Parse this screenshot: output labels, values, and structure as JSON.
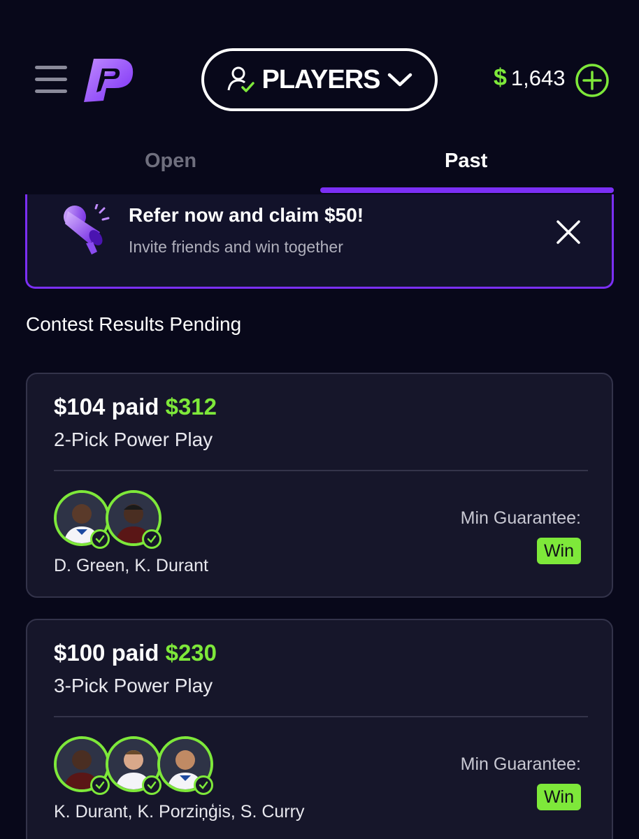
{
  "header": {
    "players_label": "PLAYERS",
    "balance_symbol": "$",
    "balance_amount": "1,643"
  },
  "tabs": [
    {
      "label": "Open",
      "active": false
    },
    {
      "label": "Past",
      "active": true
    }
  ],
  "banner": {
    "title": "Refer now and claim $50!",
    "subtitle": "Invite friends and win together"
  },
  "section_title": "Contest Results Pending",
  "contests": [
    {
      "paid": "$104 paid",
      "payout": "$312",
      "play_type": "2-Pick Power Play",
      "players": "D. Green, K. Durant",
      "min_guarantee_label": "Min Guarantee:",
      "result": "Win"
    },
    {
      "paid": "$100 paid",
      "payout": "$230",
      "play_type": "3-Pick Power Play",
      "players": "K. Durant, K. Porziņģis, S. Curry",
      "min_guarantee_label": "Min Guarantee:",
      "result": "Win"
    }
  ],
  "colors": {
    "accent_green": "#7ee83a",
    "accent_purple": "#7b2ff5",
    "background": "#08081a"
  }
}
